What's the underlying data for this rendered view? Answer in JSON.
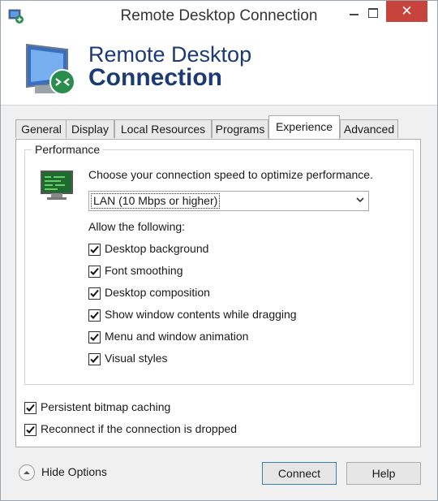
{
  "window": {
    "title": "Remote Desktop Connection",
    "close_glyph": "✕"
  },
  "banner": {
    "line1": "Remote Desktop",
    "line2": "Connection"
  },
  "tabs": [
    {
      "label": "General"
    },
    {
      "label": "Display"
    },
    {
      "label": "Local Resources"
    },
    {
      "label": "Programs"
    },
    {
      "label": "Experience",
      "active": true
    },
    {
      "label": "Advanced"
    }
  ],
  "performance": {
    "group_title": "Performance",
    "description": "Choose your connection speed to optimize performance.",
    "speed_select": {
      "value": "LAN (10 Mbps or higher)"
    },
    "allow_label": "Allow the following:",
    "options": [
      {
        "label": "Desktop background",
        "checked": true
      },
      {
        "label": "Font smoothing",
        "checked": true
      },
      {
        "label": "Desktop composition",
        "checked": true
      },
      {
        "label": "Show window contents while dragging",
        "checked": true
      },
      {
        "label": "Menu and window animation",
        "checked": true
      },
      {
        "label": "Visual styles",
        "checked": true
      }
    ]
  },
  "extra_options": [
    {
      "label": "Persistent bitmap caching",
      "checked": true
    },
    {
      "label": "Reconnect if the connection is dropped",
      "checked": true
    }
  ],
  "footer": {
    "hide_options": "Hide Options",
    "connect": "Connect",
    "help": "Help"
  },
  "colors": {
    "banner_text": "#1c3a73",
    "close_button": "#c7443c",
    "monitor_screen": "#1f6a2e"
  }
}
